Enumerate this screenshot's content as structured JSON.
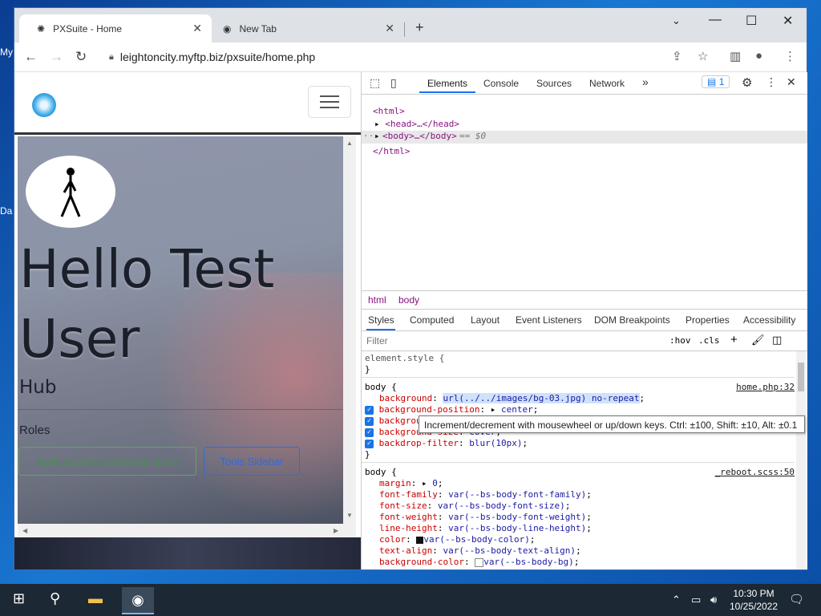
{
  "desktop": {
    "label1": "My",
    "label2": "Da"
  },
  "browser": {
    "tabs": [
      {
        "title": "PXSuite - Home",
        "active": true
      },
      {
        "title": "New Tab",
        "active": false
      }
    ],
    "url": "leightoncity.myftp.biz/pxsuite/home.php"
  },
  "page": {
    "greeting": "Hello Test User",
    "hub": "Hub",
    "roles_label": "Roles",
    "buttons": [
      "Bank account (complete open)",
      "Tools Sidebar"
    ]
  },
  "devtools": {
    "tabs": [
      "Elements",
      "Console",
      "Sources",
      "Network"
    ],
    "issues_count": "1",
    "tree": [
      "<html>",
      "<head>…</head>",
      "<body>…</body>",
      "== $0",
      "</html>"
    ],
    "breadcrumb": [
      "html",
      "body"
    ],
    "styles_tabs": [
      "Styles",
      "Computed",
      "Layout",
      "Event Listeners",
      "DOM Breakpoints",
      "Properties",
      "Accessibility"
    ],
    "filter_placeholder": "Filter",
    "filter_tools": [
      ":hov",
      ".cls"
    ],
    "element_style": "element.style {",
    "rule1": {
      "selector": "body {",
      "source": "home.php:32",
      "lines": [
        {
          "prop": "background",
          "val": "url(../../images/bg-03.jpg) no-repeat"
        },
        {
          "prop": "background-position",
          "val": "center"
        },
        {
          "prop": "background-",
          "val": ""
        },
        {
          "prop": "background-size",
          "val": "cover"
        },
        {
          "prop": "backdrop-filter",
          "val": "blur(10px)"
        }
      ]
    },
    "rule2": {
      "selector": "body {",
      "source": "_reboot.scss:50",
      "lines": [
        {
          "prop": "margin",
          "val": "0"
        },
        {
          "prop": "font-family",
          "val": "var(--bs-body-font-family)"
        },
        {
          "prop": "font-size",
          "val": "var(--bs-body-font-size)"
        },
        {
          "prop": "font-weight",
          "val": "var(--bs-body-font-weight)"
        },
        {
          "prop": "line-height",
          "val": "var(--bs-body-line-height)"
        },
        {
          "prop": "color",
          "val": "var(--bs-body-color)"
        },
        {
          "prop": "text-align",
          "val": "var(--bs-body-text-align)"
        },
        {
          "prop": "background-color",
          "val": "var(--bs-body-bg)"
        }
      ]
    },
    "tooltip": "Increment/decrement with mousewheel or up/down keys. Ctrl: ±100, Shift: ±10, Alt: ±0.1"
  },
  "taskbar": {
    "time": "10:30 PM",
    "date": "10/25/2022"
  }
}
